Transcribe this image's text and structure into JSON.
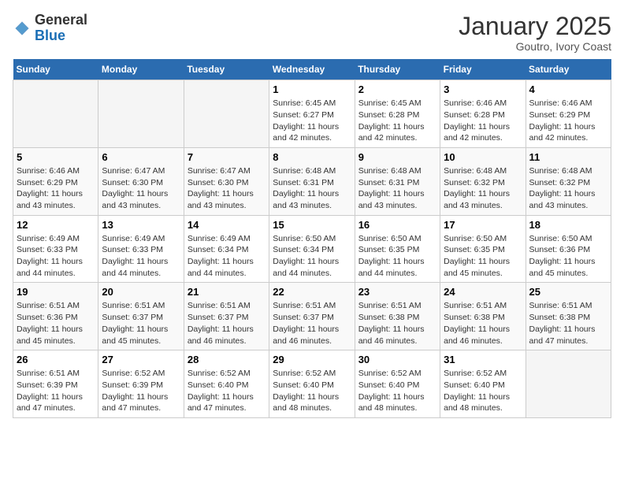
{
  "logo": {
    "general": "General",
    "blue": "Blue"
  },
  "header": {
    "month": "January 2025",
    "location": "Goutro, Ivory Coast"
  },
  "weekdays": [
    "Sunday",
    "Monday",
    "Tuesday",
    "Wednesday",
    "Thursday",
    "Friday",
    "Saturday"
  ],
  "weeks": [
    [
      {
        "day": "",
        "sunrise": "",
        "sunset": "",
        "daylight": ""
      },
      {
        "day": "",
        "sunrise": "",
        "sunset": "",
        "daylight": ""
      },
      {
        "day": "",
        "sunrise": "",
        "sunset": "",
        "daylight": ""
      },
      {
        "day": "1",
        "sunrise": "Sunrise: 6:45 AM",
        "sunset": "Sunset: 6:27 PM",
        "daylight": "Daylight: 11 hours and 42 minutes."
      },
      {
        "day": "2",
        "sunrise": "Sunrise: 6:45 AM",
        "sunset": "Sunset: 6:28 PM",
        "daylight": "Daylight: 11 hours and 42 minutes."
      },
      {
        "day": "3",
        "sunrise": "Sunrise: 6:46 AM",
        "sunset": "Sunset: 6:28 PM",
        "daylight": "Daylight: 11 hours and 42 minutes."
      },
      {
        "day": "4",
        "sunrise": "Sunrise: 6:46 AM",
        "sunset": "Sunset: 6:29 PM",
        "daylight": "Daylight: 11 hours and 42 minutes."
      }
    ],
    [
      {
        "day": "5",
        "sunrise": "Sunrise: 6:46 AM",
        "sunset": "Sunset: 6:29 PM",
        "daylight": "Daylight: 11 hours and 43 minutes."
      },
      {
        "day": "6",
        "sunrise": "Sunrise: 6:47 AM",
        "sunset": "Sunset: 6:30 PM",
        "daylight": "Daylight: 11 hours and 43 minutes."
      },
      {
        "day": "7",
        "sunrise": "Sunrise: 6:47 AM",
        "sunset": "Sunset: 6:30 PM",
        "daylight": "Daylight: 11 hours and 43 minutes."
      },
      {
        "day": "8",
        "sunrise": "Sunrise: 6:48 AM",
        "sunset": "Sunset: 6:31 PM",
        "daylight": "Daylight: 11 hours and 43 minutes."
      },
      {
        "day": "9",
        "sunrise": "Sunrise: 6:48 AM",
        "sunset": "Sunset: 6:31 PM",
        "daylight": "Daylight: 11 hours and 43 minutes."
      },
      {
        "day": "10",
        "sunrise": "Sunrise: 6:48 AM",
        "sunset": "Sunset: 6:32 PM",
        "daylight": "Daylight: 11 hours and 43 minutes."
      },
      {
        "day": "11",
        "sunrise": "Sunrise: 6:48 AM",
        "sunset": "Sunset: 6:32 PM",
        "daylight": "Daylight: 11 hours and 43 minutes."
      }
    ],
    [
      {
        "day": "12",
        "sunrise": "Sunrise: 6:49 AM",
        "sunset": "Sunset: 6:33 PM",
        "daylight": "Daylight: 11 hours and 44 minutes."
      },
      {
        "day": "13",
        "sunrise": "Sunrise: 6:49 AM",
        "sunset": "Sunset: 6:33 PM",
        "daylight": "Daylight: 11 hours and 44 minutes."
      },
      {
        "day": "14",
        "sunrise": "Sunrise: 6:49 AM",
        "sunset": "Sunset: 6:34 PM",
        "daylight": "Daylight: 11 hours and 44 minutes."
      },
      {
        "day": "15",
        "sunrise": "Sunrise: 6:50 AM",
        "sunset": "Sunset: 6:34 PM",
        "daylight": "Daylight: 11 hours and 44 minutes."
      },
      {
        "day": "16",
        "sunrise": "Sunrise: 6:50 AM",
        "sunset": "Sunset: 6:35 PM",
        "daylight": "Daylight: 11 hours and 44 minutes."
      },
      {
        "day": "17",
        "sunrise": "Sunrise: 6:50 AM",
        "sunset": "Sunset: 6:35 PM",
        "daylight": "Daylight: 11 hours and 45 minutes."
      },
      {
        "day": "18",
        "sunrise": "Sunrise: 6:50 AM",
        "sunset": "Sunset: 6:36 PM",
        "daylight": "Daylight: 11 hours and 45 minutes."
      }
    ],
    [
      {
        "day": "19",
        "sunrise": "Sunrise: 6:51 AM",
        "sunset": "Sunset: 6:36 PM",
        "daylight": "Daylight: 11 hours and 45 minutes."
      },
      {
        "day": "20",
        "sunrise": "Sunrise: 6:51 AM",
        "sunset": "Sunset: 6:37 PM",
        "daylight": "Daylight: 11 hours and 45 minutes."
      },
      {
        "day": "21",
        "sunrise": "Sunrise: 6:51 AM",
        "sunset": "Sunset: 6:37 PM",
        "daylight": "Daylight: 11 hours and 46 minutes."
      },
      {
        "day": "22",
        "sunrise": "Sunrise: 6:51 AM",
        "sunset": "Sunset: 6:37 PM",
        "daylight": "Daylight: 11 hours and 46 minutes."
      },
      {
        "day": "23",
        "sunrise": "Sunrise: 6:51 AM",
        "sunset": "Sunset: 6:38 PM",
        "daylight": "Daylight: 11 hours and 46 minutes."
      },
      {
        "day": "24",
        "sunrise": "Sunrise: 6:51 AM",
        "sunset": "Sunset: 6:38 PM",
        "daylight": "Daylight: 11 hours and 46 minutes."
      },
      {
        "day": "25",
        "sunrise": "Sunrise: 6:51 AM",
        "sunset": "Sunset: 6:38 PM",
        "daylight": "Daylight: 11 hours and 47 minutes."
      }
    ],
    [
      {
        "day": "26",
        "sunrise": "Sunrise: 6:51 AM",
        "sunset": "Sunset: 6:39 PM",
        "daylight": "Daylight: 11 hours and 47 minutes."
      },
      {
        "day": "27",
        "sunrise": "Sunrise: 6:52 AM",
        "sunset": "Sunset: 6:39 PM",
        "daylight": "Daylight: 11 hours and 47 minutes."
      },
      {
        "day": "28",
        "sunrise": "Sunrise: 6:52 AM",
        "sunset": "Sunset: 6:40 PM",
        "daylight": "Daylight: 11 hours and 47 minutes."
      },
      {
        "day": "29",
        "sunrise": "Sunrise: 6:52 AM",
        "sunset": "Sunset: 6:40 PM",
        "daylight": "Daylight: 11 hours and 48 minutes."
      },
      {
        "day": "30",
        "sunrise": "Sunrise: 6:52 AM",
        "sunset": "Sunset: 6:40 PM",
        "daylight": "Daylight: 11 hours and 48 minutes."
      },
      {
        "day": "31",
        "sunrise": "Sunrise: 6:52 AM",
        "sunset": "Sunset: 6:40 PM",
        "daylight": "Daylight: 11 hours and 48 minutes."
      },
      {
        "day": "",
        "sunrise": "",
        "sunset": "",
        "daylight": ""
      }
    ]
  ]
}
